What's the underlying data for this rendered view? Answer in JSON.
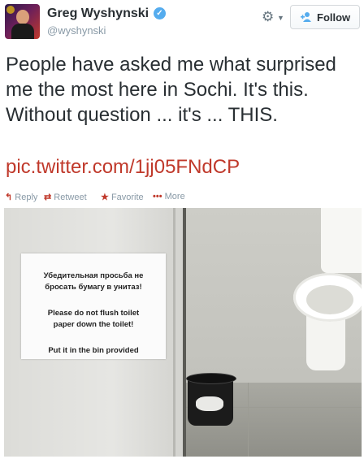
{
  "header": {
    "name": "Greg Wyshynski",
    "handle": "@wyshynski",
    "verified_glyph": "✓",
    "settings_icon": "gear-icon",
    "follow_label": "Follow"
  },
  "tweet": {
    "text": "People have asked me what surprised me the most here in Sochi. It's this. Without question ... it's ... THIS.",
    "link": "pic.twitter.com/1jj05FNdCP",
    "link_color": "#c0392b"
  },
  "actions": {
    "reply": "Reply",
    "retweet": "Retweet",
    "favorite": "Favorite",
    "more": "More",
    "reply_icon": "reply-icon",
    "retweet_icon": "retweet-icon",
    "favorite_icon": "star-icon",
    "more_icon": "ellipsis-icon"
  },
  "photo": {
    "sign_lines": [
      "Убедительная просьба не",
      "бросать бумагу в унитаз!",
      "Please do not flush toilet",
      "paper down the toilet!",
      "Put it in the bin provided"
    ]
  }
}
